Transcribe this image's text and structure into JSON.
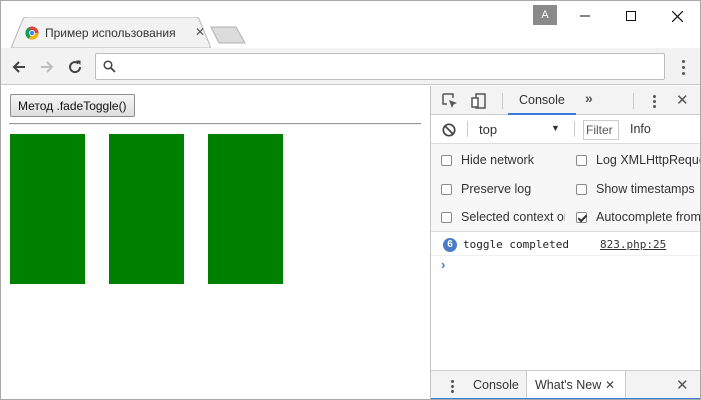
{
  "window": {
    "profile_label": "A",
    "minimize_symbol": "—",
    "maximize_symbol": "☐",
    "close_symbol": "✕"
  },
  "tab": {
    "title": "Пример использования",
    "close_symbol": "✕",
    "favicon": "chrome-favicon"
  },
  "toolbar": {
    "back_icon": "arrow-left-icon",
    "forward_icon": "arrow-right-icon",
    "reload_icon": "reload-icon",
    "omnibox_value": "",
    "menu_icon": "kebab-menu-icon"
  },
  "page": {
    "button_label": "Метод .fadeToggle()",
    "box_color": "#008000",
    "boxes": [
      "box-1",
      "box-2",
      "box-3"
    ]
  },
  "devtools": {
    "tabs": {
      "console": "Console",
      "more": "»"
    },
    "close_symbol": "✕",
    "filterbar": {
      "context": "top",
      "context_arrow": "▼",
      "filter_placeholder": "Filter",
      "level": "Info"
    },
    "settings": {
      "hide_network": "Hide network",
      "preserve_log": "Preserve log",
      "selected_context": "Selected context only",
      "log_xhr": "Log XMLHttpRequests",
      "show_timestamps": "Show timestamps",
      "autocomplete": "Autocomplete from history"
    },
    "message": {
      "count": "6",
      "text": "toggle completed",
      "source": "823.php:25"
    },
    "prompt": "›",
    "drawer": {
      "console_tab": "Console",
      "whats_new_tab": "What's New",
      "tab_close": "✕",
      "close_symbol": "✕"
    },
    "accent_color": "#3879d9"
  }
}
